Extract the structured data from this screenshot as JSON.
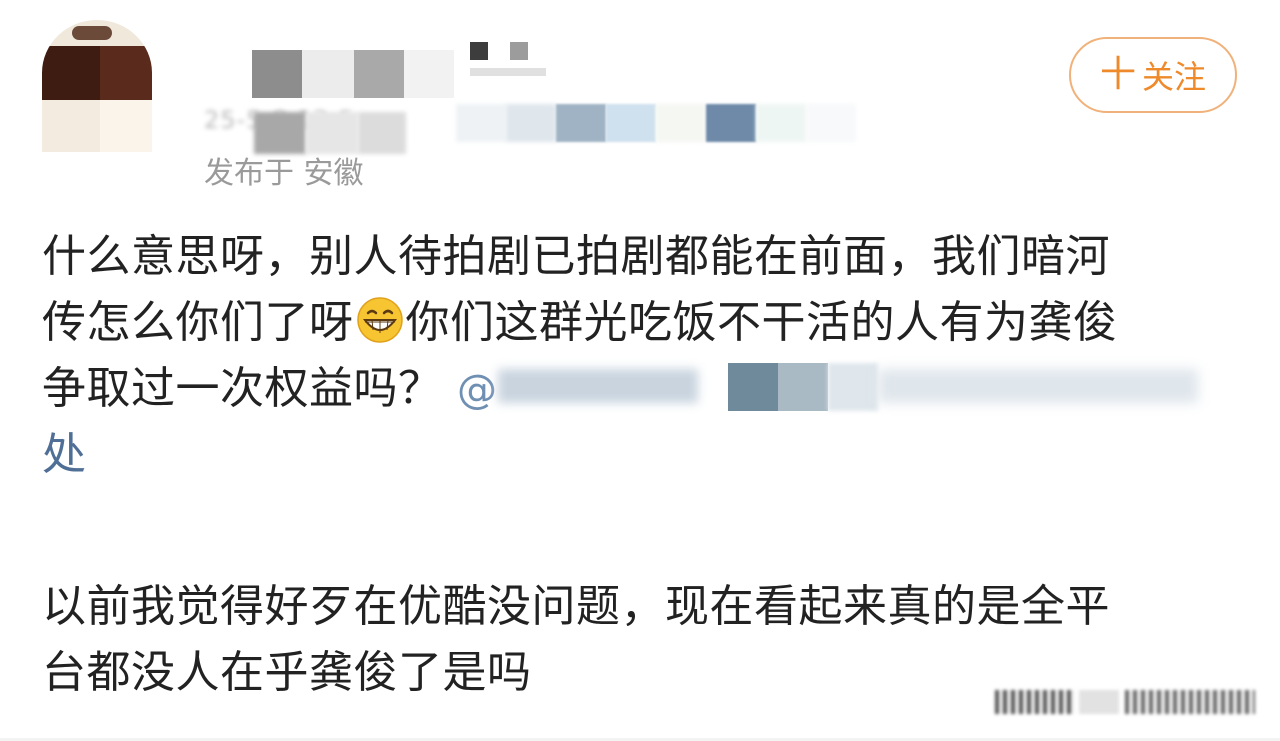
{
  "header": {
    "location": "发布于 安徽",
    "date_partial": "25-5-8 12:5",
    "follow_label": "+关注",
    "follow_plus": "十",
    "follow_text": "关注"
  },
  "post": {
    "paragraph1_lines": [
      "什么意思呀，别人待拍剧已拍剧都能在前面，我们暗河",
      "传怎么你们了呀",
      "你们这群光吃饭不干活的人有为龚俊",
      "争取过一次权益吗？"
    ],
    "mention_symbol": "@",
    "mention_tail": "处",
    "paragraph2_lines": [
      "以前我觉得好歹在优酷没问题，现在看起来真的是全平",
      "台都没人在乎龚俊了是吗"
    ]
  },
  "icons": {
    "emoji": "grinning-face-with-teeth-emoji",
    "follow": "plus-icon"
  },
  "colors": {
    "accent_orange": "#ee8a2a",
    "follow_border": "#f0b27a",
    "link_blue": "#4f6f97",
    "meta_gray": "#9a9a9a",
    "text": "#222222"
  }
}
